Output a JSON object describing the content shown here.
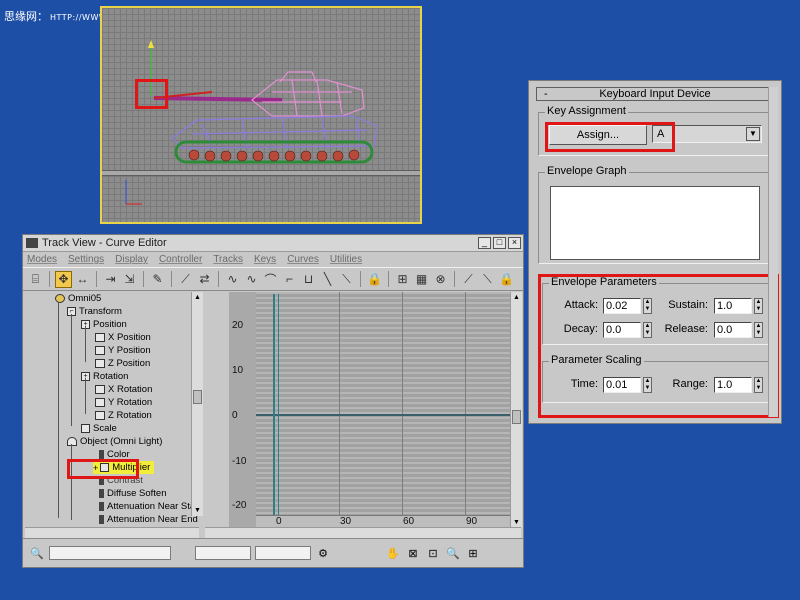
{
  "watermark": {
    "site_name": "思缘网：",
    "url": "HTTP://WWW.MISSYUAN.NET"
  },
  "colors": {
    "desktop": "#1d4fa6",
    "highlight_box": "#e01616",
    "viewport_border": "#e8d44a",
    "tank_tracks": "#2e8b3a",
    "tank_body": "#8a7ce0",
    "tank_turret": "#e090d0",
    "selected_item": "#f2ed3a"
  },
  "track_view": {
    "title": "Track View - Curve Editor",
    "window_buttons": [
      "_",
      "□",
      "×"
    ],
    "menu": [
      "Modes",
      "Settings",
      "Display",
      "Controller",
      "Tracks",
      "Keys",
      "Curves",
      "Utilities"
    ],
    "tree": [
      {
        "label": "Omni05",
        "icon": "light-icon"
      },
      {
        "label": "Transform",
        "icon": "transform-icon"
      },
      {
        "label": "Position",
        "icon": "position-icon"
      },
      {
        "label": "X Position",
        "icon": "track-icon"
      },
      {
        "label": "Y Position",
        "icon": "track-icon"
      },
      {
        "label": "Z Position",
        "icon": "track-icon"
      },
      {
        "label": "Rotation",
        "icon": "rotation-icon"
      },
      {
        "label": "X Rotation",
        "icon": "track-icon"
      },
      {
        "label": "Y Rotation",
        "icon": "track-icon"
      },
      {
        "label": "Z Rotation",
        "icon": "track-icon"
      },
      {
        "label": "Scale",
        "icon": "scale-icon"
      },
      {
        "label": "Object (Omni Light)",
        "icon": "object-icon"
      },
      {
        "label": "Color",
        "icon": "param-icon"
      },
      {
        "label": "Multiplier",
        "icon": "param-icon",
        "selected": true
      },
      {
        "label": "Contrast",
        "icon": "param-icon"
      },
      {
        "label": "Diffuse Soften",
        "icon": "param-icon"
      },
      {
        "label": "Attenuation Near Start",
        "icon": "param-icon"
      },
      {
        "label": "Attenuation Near End",
        "icon": "param-icon"
      }
    ],
    "curve_editor": {
      "y_ticks": [
        "20",
        "10",
        "0",
        "-10",
        "-20"
      ],
      "x_ticks": [
        "0",
        "30",
        "60",
        "90"
      ]
    }
  },
  "keyboard_panel": {
    "rollout_minus": "-",
    "rollout_title": "Keyboard Input Device",
    "key_assignment": {
      "group_label": "Key Assignment",
      "assign_button": "Assign...",
      "assigned_key": "A"
    },
    "envelope_graph": {
      "group_label": "Envelope Graph"
    },
    "envelope_parameters": {
      "group_label": "Envelope Parameters",
      "attack_label": "Attack:",
      "attack_value": "0.02",
      "sustain_label": "Sustain:",
      "sustain_value": "1.0",
      "decay_label": "Decay:",
      "decay_value": "0.0",
      "release_label": "Release:",
      "release_value": "0.0"
    },
    "parameter_scaling": {
      "group_label": "Parameter Scaling",
      "time_label": "Time:",
      "time_value": "0.01",
      "range_label": "Range:",
      "range_value": "1.0"
    }
  }
}
